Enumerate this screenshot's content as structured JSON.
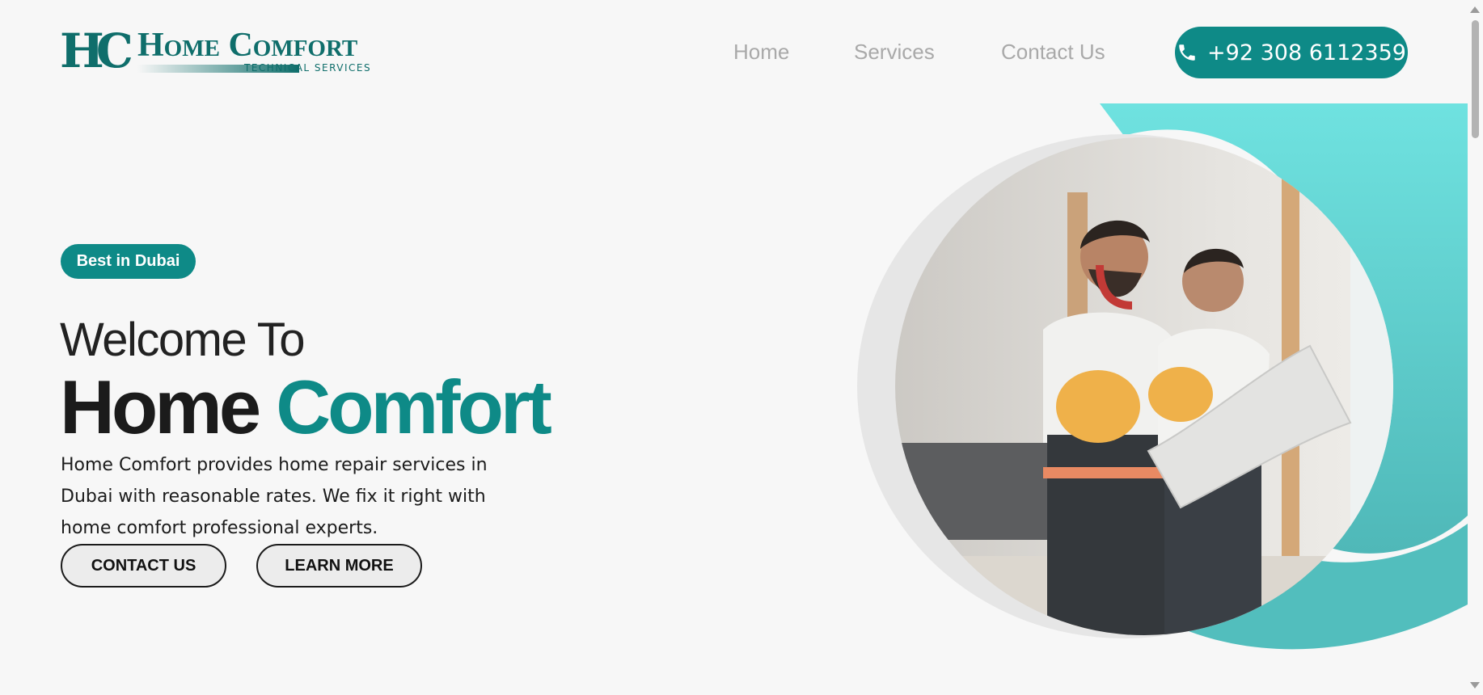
{
  "header": {
    "logo": {
      "monogram": "HC",
      "name": "Home Comfort",
      "tagline": "TECHNICAL SERVICES"
    },
    "nav": [
      {
        "label": "Home"
      },
      {
        "label": "Services"
      },
      {
        "label": "Contact Us"
      }
    ],
    "phone": {
      "label": "+92 308 6112359",
      "icon": "phone-icon"
    }
  },
  "hero": {
    "badge": "Best in Dubai",
    "welcome": "Welcome To",
    "title_dark": "Home",
    "title_accent": "Comfort",
    "description": "Home Comfort provides home repair services in Dubai with reasonable rates. We fix it right with home comfort professional experts.",
    "buttons": [
      {
        "label": "CONTACT US"
      },
      {
        "label": "LEARN MORE"
      }
    ],
    "image": "two-workers-with-hardhats-reading-blueprint"
  },
  "colors": {
    "accent": "#0e8a87",
    "accent_light": "#6fdedd",
    "nav_text": "#a9a9a9",
    "background": "#f7f7f7"
  }
}
